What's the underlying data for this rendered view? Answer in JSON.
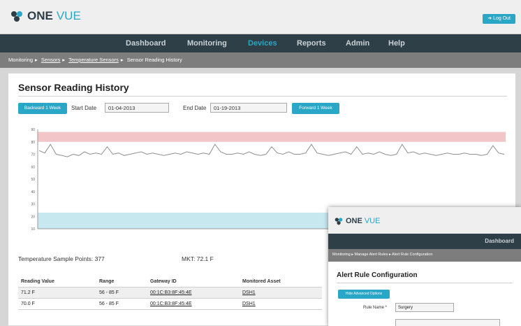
{
  "app": {
    "logo_one": "ONE",
    "logo_vue": "VUE",
    "logout": "Log Out"
  },
  "nav": [
    "Dashboard",
    "Monitoring",
    "Devices",
    "Reports",
    "Admin",
    "Help"
  ],
  "nav_active": "Devices",
  "breadcrumb": {
    "items": [
      "Monitoring",
      "Sensors",
      "Temperature Sensors",
      "Sensor Reading History"
    ],
    "sep": "▸"
  },
  "page": {
    "title": "Sensor Reading History"
  },
  "filters": {
    "back_button": "Backward 1 Week",
    "start_label": "Start Date",
    "start_value": "01-04-2013",
    "end_label": "End Date",
    "end_value": "01-19-2013",
    "forward_button": "Forward 1 Week"
  },
  "chart_data": {
    "type": "line",
    "series": [
      {
        "values": [
          73,
          71,
          78,
          70,
          69,
          68,
          70,
          69,
          72,
          70,
          71,
          70,
          76,
          70,
          71,
          69,
          70,
          71,
          72,
          70,
          71,
          70,
          69,
          70,
          71,
          70,
          72,
          71,
          70,
          71,
          70,
          78,
          72,
          70,
          70,
          71,
          70,
          72,
          70,
          69,
          70,
          76,
          71,
          70,
          72,
          70,
          70,
          71,
          78,
          71,
          70,
          69,
          70,
          71,
          72,
          70,
          76,
          70,
          71,
          70,
          72,
          70,
          69,
          70,
          78,
          71,
          72,
          70,
          71,
          70,
          69,
          70,
          71,
          70,
          70,
          71,
          70,
          70,
          69,
          70,
          77,
          71,
          70
        ]
      }
    ],
    "ylim": [
      10,
      90
    ],
    "y_ticks": [
      "90",
      "80",
      "70",
      "60",
      "50",
      "40",
      "30",
      "20",
      "10"
    ],
    "bands": [
      {
        "from": 80,
        "to": 88,
        "color": "#f2c6c8"
      },
      {
        "from": 10,
        "to": 23,
        "color": "#c6e8ee"
      }
    ],
    "line_color": "#8f8f8f"
  },
  "stats": {
    "sample_points": "Temperature Sample Points: 377",
    "mkt": "MKT: 72.1 F"
  },
  "table": {
    "headers": [
      "Reading Value",
      "Range",
      "Gateway ID",
      "Monitored Asset"
    ],
    "rows": [
      [
        "71.2 F",
        "56 - 85 F",
        "00:1C:B3:8F:45:4E",
        "DSH1"
      ],
      [
        "70.0 F",
        "56 - 85 F",
        "00:1C:B3:8F:45:4E",
        "DSH1"
      ]
    ]
  },
  "overlay": {
    "logo_one": "ONE",
    "logo_vue": "VUE",
    "nav_item": "Dashboard",
    "crumb": "Monitoring ▸ Manage Alert Rules ▸ Alert Rule Configuration",
    "title": "Alert Rule Configuration",
    "button": "Hide Advanced Options",
    "rule_label": "Rule Name *",
    "rule_value": "Surgery"
  }
}
